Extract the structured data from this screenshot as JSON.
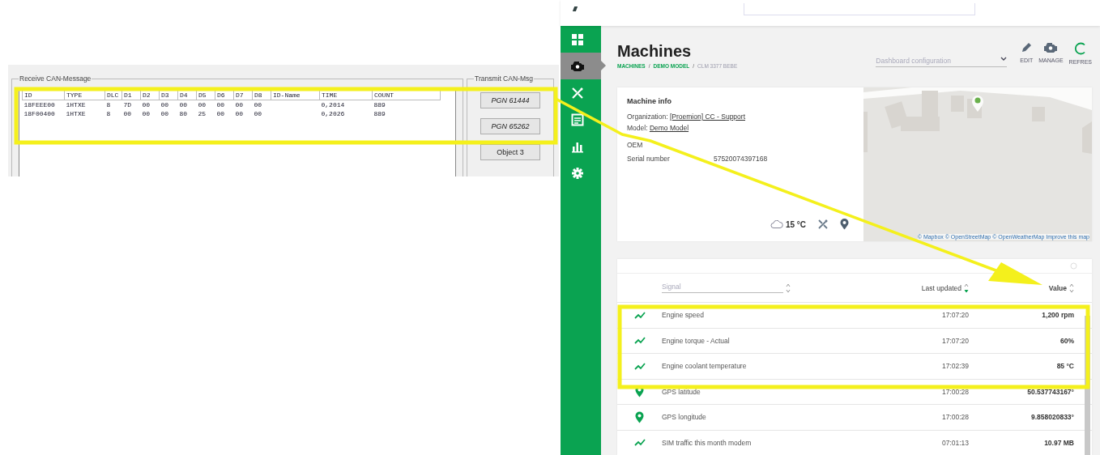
{
  "can_window": {
    "receive_group": "Receive CAN-Message",
    "transmit_group": "Transmit CAN-Msg",
    "columns": [
      "ID",
      "TYPE",
      "DLC",
      "D1",
      "D2",
      "D3",
      "D4",
      "D5",
      "D6",
      "D7",
      "D8",
      "ID-Name",
      "TIME",
      "COUNT"
    ],
    "rows": [
      [
        "18FEEE00",
        "1HTXE",
        "8",
        "7D",
        "00",
        "00",
        "00",
        "00",
        "00",
        "00",
        "00",
        "",
        "0,2014",
        "889"
      ],
      [
        "18F00400",
        "1HTXE",
        "8",
        "00",
        "00",
        "00",
        "80",
        "25",
        "00",
        "00",
        "00",
        "",
        "0,2026",
        "889"
      ]
    ],
    "buttons": [
      {
        "label": "PGN 61444",
        "italic": true
      },
      {
        "label": "PGN 65262",
        "italic": true
      },
      {
        "label": "Object 3",
        "italic": false
      }
    ]
  },
  "dashboard": {
    "sidebar": {
      "items": [
        {
          "selected": false
        },
        {
          "selected": true
        },
        {
          "selected": false
        },
        {
          "selected": false
        },
        {
          "selected": false
        },
        {
          "selected": false
        }
      ]
    },
    "title": "Machines",
    "breadcrumb": [
      {
        "label": "MACHINES",
        "current": false
      },
      {
        "separator": "/",
        "label": "DEMO MODEL",
        "current": false
      },
      {
        "separator": "/",
        "label": "CLM 3377 BEBE",
        "current": true
      }
    ],
    "dashboard_select": {
      "placeholder": "Dashboard configuration"
    },
    "actions": [
      {
        "label": "EDIT"
      },
      {
        "label": "MANAGE"
      },
      {
        "label": "REFRES"
      }
    ],
    "machine_info": {
      "title": "Machine info",
      "fields": [
        {
          "label": "Organization:",
          "value": "[Proemion] CC - Support"
        },
        {
          "label": "Model:",
          "value": "Demo Model"
        },
        {
          "label": "OEM"
        },
        {
          "label": "Serial number",
          "value": "57520074397168"
        }
      ],
      "temperature": "15 °C",
      "map_attribution": "© Mapbox © OpenStreetMap © OpenWeatherMap Improve this map"
    },
    "signals": {
      "columns": [
        {
          "kind": "filter",
          "placeholder": "Signal",
          "sorted": false
        },
        {
          "kind": "text",
          "label": "Last updated",
          "sorted": true
        },
        {
          "kind": "text",
          "label": "Value",
          "sorted": false
        }
      ],
      "rows": [
        {
          "kind": "trend",
          "name": "Engine speed",
          "updated": "17:07:20",
          "value": "1,200 rpm"
        },
        {
          "kind": "trend",
          "name": "Engine torque - Actual",
          "updated": "17:07:20",
          "value": "60%"
        },
        {
          "kind": "trend",
          "name": "Engine coolant temperature",
          "updated": "17:02:39",
          "value": "85 °C"
        },
        {
          "kind": "location",
          "name": "GPS latitude",
          "updated": "17:00:28",
          "value": "50.537743167°"
        },
        {
          "kind": "location",
          "name": "GPS longitude",
          "updated": "17:00:28",
          "value": "9.858020833°"
        },
        {
          "kind": "trend",
          "name": "SIM traffic this month modem",
          "updated": "07:01:13",
          "value": "10.97 MB"
        }
      ]
    }
  }
}
